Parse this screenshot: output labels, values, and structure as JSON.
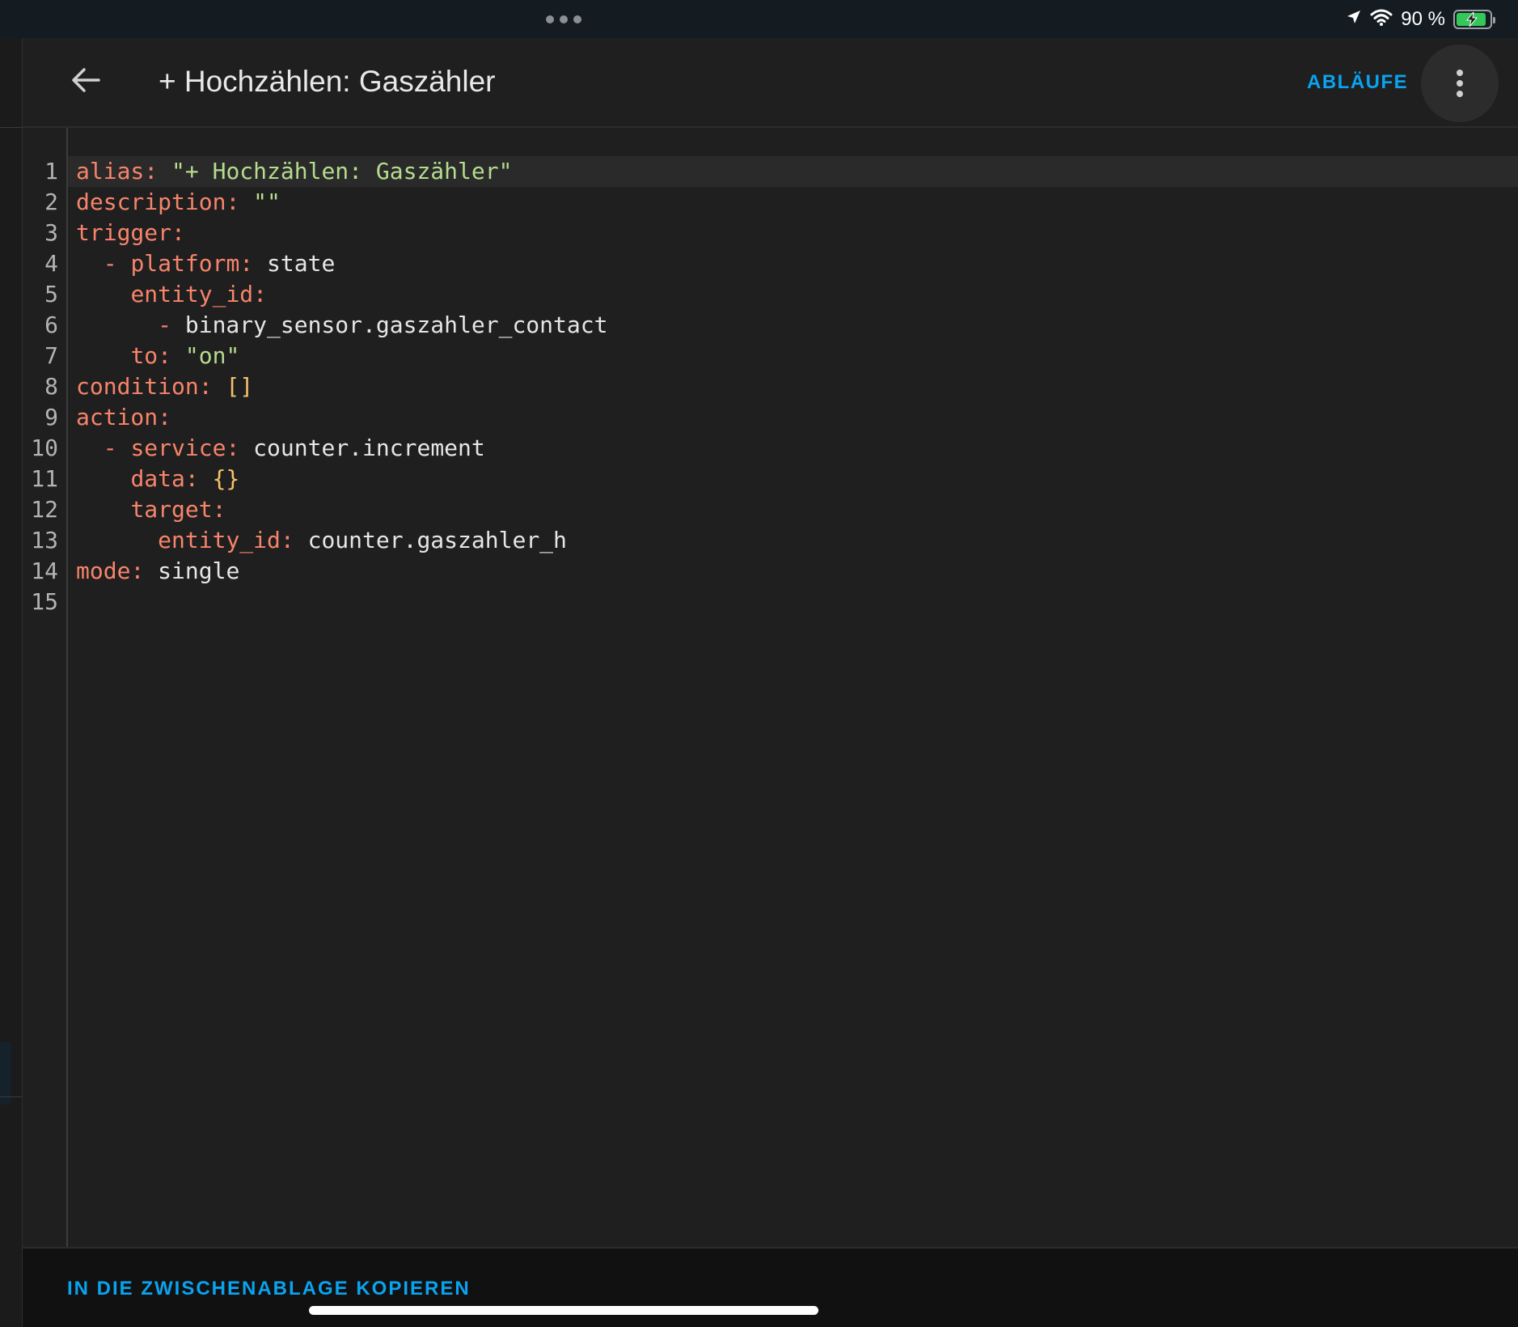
{
  "status": {
    "battery_text": "90 %",
    "battery_level": 0.9,
    "accent": "#34c759"
  },
  "toolbar": {
    "title": "+ Hochzählen: Gaszähler",
    "action_label": "ABLÄUFE",
    "back_icon": "arrow-left-icon",
    "menu_icon": "dots-vertical-icon"
  },
  "editor": {
    "lines": [
      [
        {
          "t": "alias",
          "c": "k"
        },
        {
          "t": ": ",
          "c": "k"
        },
        {
          "t": "\"+ Hochzählen: Gaszähler\"",
          "c": "s"
        }
      ],
      [
        {
          "t": "description",
          "c": "k"
        },
        {
          "t": ": ",
          "c": "k"
        },
        {
          "t": "\"\"",
          "c": "s"
        }
      ],
      [
        {
          "t": "trigger",
          "c": "k"
        },
        {
          "t": ":",
          "c": "k"
        }
      ],
      [
        {
          "t": "  - ",
          "c": "k"
        },
        {
          "t": "platform",
          "c": "k"
        },
        {
          "t": ": ",
          "c": "k"
        },
        {
          "t": "state",
          "c": "p"
        }
      ],
      [
        {
          "t": "    ",
          "c": "p"
        },
        {
          "t": "entity_id",
          "c": "k"
        },
        {
          "t": ":",
          "c": "k"
        }
      ],
      [
        {
          "t": "      - ",
          "c": "k"
        },
        {
          "t": "binary_sensor.gaszahler_contact",
          "c": "p"
        }
      ],
      [
        {
          "t": "    ",
          "c": "p"
        },
        {
          "t": "to",
          "c": "k"
        },
        {
          "t": ": ",
          "c": "k"
        },
        {
          "t": "\"on\"",
          "c": "s"
        }
      ],
      [
        {
          "t": "condition",
          "c": "k"
        },
        {
          "t": ": ",
          "c": "k"
        },
        {
          "t": "[]",
          "c": "b"
        }
      ],
      [
        {
          "t": "action",
          "c": "k"
        },
        {
          "t": ":",
          "c": "k"
        }
      ],
      [
        {
          "t": "  - ",
          "c": "k"
        },
        {
          "t": "service",
          "c": "k"
        },
        {
          "t": ": ",
          "c": "k"
        },
        {
          "t": "counter.increment",
          "c": "p"
        }
      ],
      [
        {
          "t": "    ",
          "c": "p"
        },
        {
          "t": "data",
          "c": "k"
        },
        {
          "t": ": ",
          "c": "k"
        },
        {
          "t": "{}",
          "c": "b"
        }
      ],
      [
        {
          "t": "    ",
          "c": "p"
        },
        {
          "t": "target",
          "c": "k"
        },
        {
          "t": ":",
          "c": "k"
        }
      ],
      [
        {
          "t": "      ",
          "c": "p"
        },
        {
          "t": "entity_id",
          "c": "k"
        },
        {
          "t": ": ",
          "c": "k"
        },
        {
          "t": "counter.gaszahler_h",
          "c": "p"
        }
      ],
      [
        {
          "t": "mode",
          "c": "k"
        },
        {
          "t": ": ",
          "c": "k"
        },
        {
          "t": "single",
          "c": "p"
        }
      ],
      []
    ],
    "active_line": 1
  },
  "footer": {
    "copy_label": "IN DIE ZWISCHENABLAGE KOPIEREN"
  }
}
